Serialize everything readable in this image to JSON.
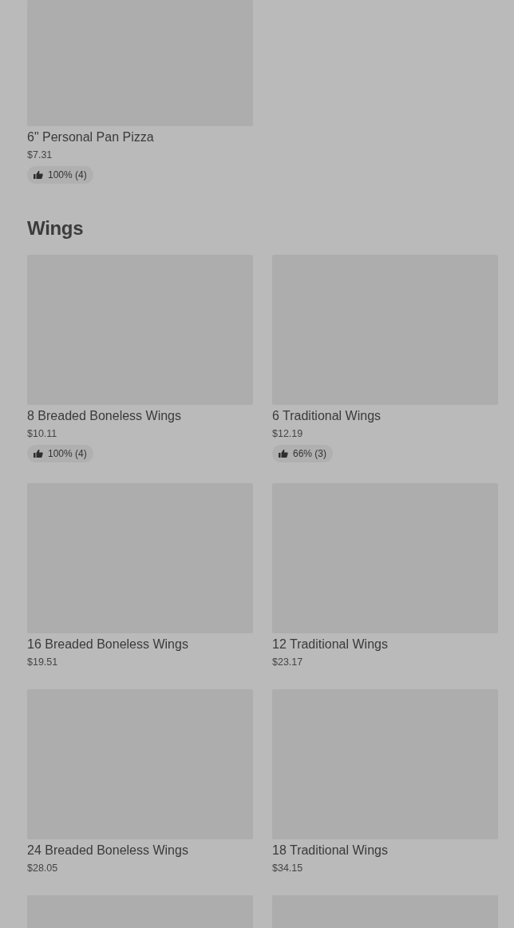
{
  "sections": [
    {
      "items": [
        {
          "kind": "full",
          "cropped": true,
          "name": "6\" Personal Pan Pizza",
          "price": "$7.31",
          "rating": "100% (4)"
        }
      ]
    },
    {
      "title": "Wings",
      "items": [
        {
          "kind": "full",
          "name": "8 Breaded Boneless Wings",
          "price": "$10.11",
          "rating": "100% (4)"
        },
        {
          "kind": "full",
          "name": "6 Traditional Wings",
          "price": "$12.19",
          "rating": "66% (3)"
        },
        {
          "kind": "full",
          "name": "16 Breaded Boneless Wings",
          "price": "$19.51"
        },
        {
          "kind": "full",
          "name": "12 Traditional Wings",
          "price": "$23.17"
        },
        {
          "kind": "full",
          "name": "24 Breaded Boneless Wings",
          "price": "$28.05"
        },
        {
          "kind": "full",
          "name": "18 Traditional Wings",
          "price": "$34.15"
        },
        {
          "kind": "image-only"
        },
        {
          "kind": "image-only"
        }
      ]
    }
  ]
}
